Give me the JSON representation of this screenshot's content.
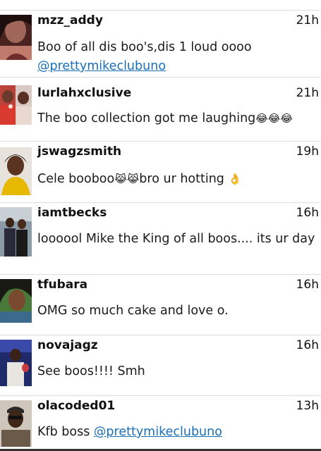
{
  "comments": [
    {
      "username": "mzz_addy",
      "time": "21h",
      "text": "Boo of all dis boo's,dis 1 loud oooo",
      "mention": "@prettymikeclubuno"
    },
    {
      "username": "lurlahxclusive",
      "time": "21h",
      "text": "The boo collection got me laughing",
      "emoji": "😂😂😂"
    },
    {
      "username": "jswagzsmith",
      "time": "19h",
      "text_a": "Cele booboo",
      "emoji_a": "😹😹",
      "text_b": "bro ur hotting ",
      "emoji_b": "👌"
    },
    {
      "username": "iamtbecks",
      "time": "16h",
      "text": "loooool Mike the King of all boos.... its ur day"
    },
    {
      "username": "tfubara",
      "time": "16h",
      "text": "OMG so much cake and love o."
    },
    {
      "username": "novajagz",
      "time": "16h",
      "text": "See boos!!!! Smh"
    },
    {
      "username": "olacoded01",
      "time": "13h",
      "text": "Kfb boss ",
      "mention": "@prettymikeclubuno"
    }
  ]
}
